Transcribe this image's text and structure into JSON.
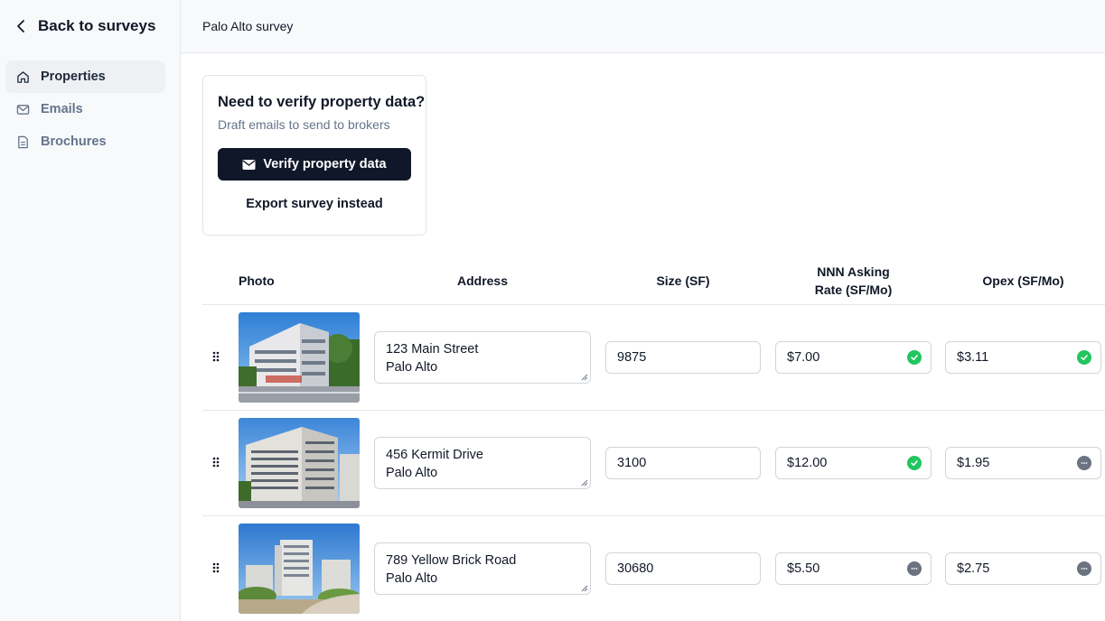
{
  "sidebar": {
    "back_label": "Back to surveys",
    "items": [
      {
        "label": "Properties",
        "icon": "home-icon",
        "active": true
      },
      {
        "label": "Emails",
        "icon": "mail-icon",
        "active": false
      },
      {
        "label": "Brochures",
        "icon": "document-icon",
        "active": false
      }
    ]
  },
  "header": {
    "title": "Palo Alto survey"
  },
  "card": {
    "title": "Need to verify property data?",
    "subtitle": "Draft emails to send to brokers",
    "verify_label": "Verify property data",
    "export_label": "Export survey instead"
  },
  "table": {
    "columns": {
      "photo": "Photo",
      "address": "Address",
      "size": "Size (SF)",
      "rate_line1": "NNN Asking",
      "rate_line2": "Rate (SF/Mo)",
      "opex": "Opex (SF/Mo)"
    },
    "rows": [
      {
        "address": "123 Main Street\nPalo Alto",
        "size": "9875",
        "rate": "$7.00",
        "rate_status": "verified",
        "opex": "$3.11",
        "opex_status": "verified"
      },
      {
        "address": "456 Kermit Drive\nPalo Alto",
        "size": "3100",
        "rate": "$12.00",
        "rate_status": "verified",
        "opex": "$1.95",
        "opex_status": "pending"
      },
      {
        "address": "789 Yellow Brick Road\nPalo Alto",
        "size": "30680",
        "rate": "$5.50",
        "rate_status": "pending",
        "opex": "$2.75",
        "opex_status": "pending"
      }
    ]
  },
  "colors": {
    "primary_button": "#0f1729",
    "verified": "#22c55e",
    "pending": "#6b7280",
    "sidebar_bg": "#f8f9fb",
    "active_nav_bg": "#eef0f4"
  }
}
